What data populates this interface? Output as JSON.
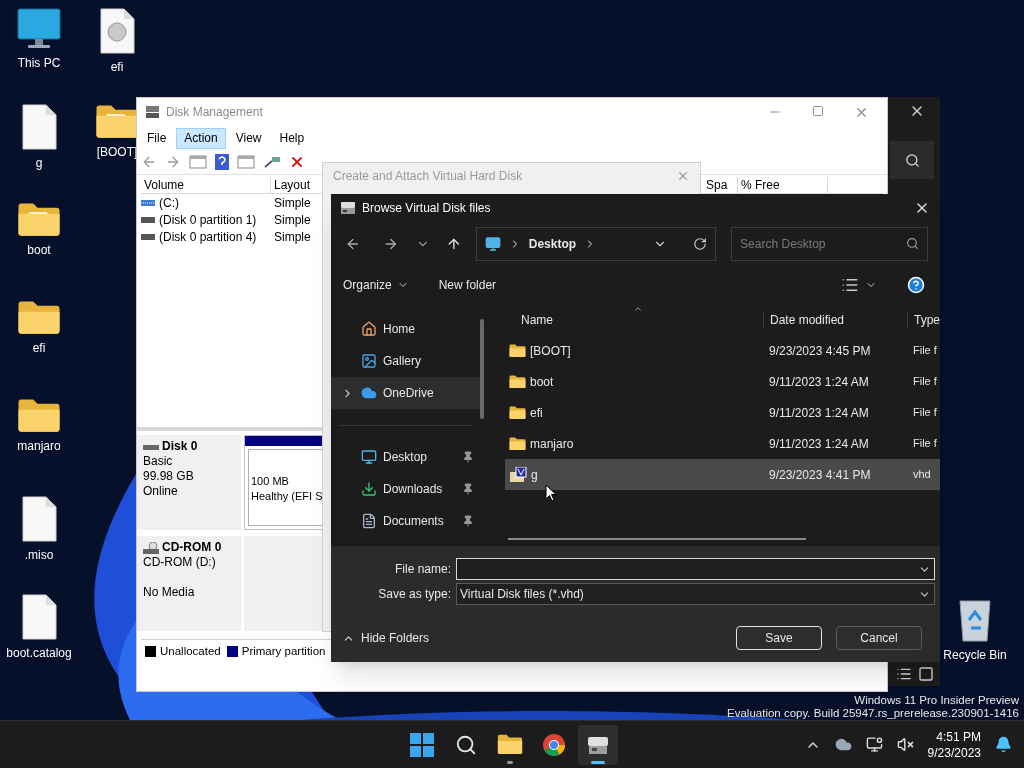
{
  "desktop": {
    "icons": [
      {
        "label": "This PC",
        "kind": "pc"
      },
      {
        "label": "g",
        "kind": "file"
      },
      {
        "label": "boot",
        "kind": "doc-folder"
      },
      {
        "label": "efi",
        "kind": "folder"
      },
      {
        "label": "manjaro",
        "kind": "folder"
      },
      {
        "label": ".miso",
        "kind": "file"
      },
      {
        "label": "boot.catalog",
        "kind": "file"
      },
      {
        "label": "efi",
        "kind": "disc-file"
      },
      {
        "label": "[BOOT]",
        "kind": "doc-folder"
      }
    ],
    "recycle_bin": {
      "label": "Recycle Bin"
    },
    "watermark": [
      "Windows 11 Pro Insider Preview",
      "Evaluation copy. Build 25947.rs_prerelease.230901-1416"
    ]
  },
  "disk_management": {
    "title": "Disk Management",
    "menu": [
      {
        "label": "File",
        "selected": false
      },
      {
        "label": "Action",
        "selected": true
      },
      {
        "label": "View",
        "selected": false
      },
      {
        "label": "Help",
        "selected": false
      }
    ],
    "volume_table": {
      "columns": [
        "Volume",
        "Layout",
        "Spa",
        "% Free"
      ],
      "rows": [
        {
          "volume": "(C:)",
          "layout": "Simple",
          "kind": "striped"
        },
        {
          "volume": "(Disk 0 partition 1)",
          "layout": "Simple",
          "kind": "plain"
        },
        {
          "volume": "(Disk 0 partition 4)",
          "layout": "Simple",
          "kind": "plain"
        }
      ]
    },
    "disks": [
      {
        "name": "Disk 0",
        "kind": "disk",
        "type": "Basic",
        "capacity": "99.98 GB",
        "status": "Online",
        "partition": {
          "size": "100 MB",
          "status": "Healthy (EFI S"
        }
      },
      {
        "name": "CD-ROM 0",
        "kind": "cdrom",
        "type": "CD-ROM (D:)",
        "status": "No Media"
      }
    ],
    "legend": [
      {
        "label": "Unallocated",
        "color": "#000000"
      },
      {
        "label": "Primary partition",
        "color": "#000080"
      }
    ]
  },
  "create_dialog": {
    "title": "Create and Attach Virtual Hard Disk"
  },
  "browse_dialog": {
    "title": "Browse Virtual Disk files",
    "address": {
      "location": "Desktop"
    },
    "search": {
      "placeholder": "Search Desktop"
    },
    "commands": [
      "Organize",
      "New folder"
    ],
    "nav": [
      {
        "label": "Home",
        "kind": "home",
        "selected": false,
        "expandable": false,
        "pinned": false
      },
      {
        "label": "Gallery",
        "kind": "gallery",
        "selected": false,
        "expandable": false,
        "pinned": false
      },
      {
        "label": "OneDrive",
        "kind": "cloud",
        "selected": true,
        "expandable": true,
        "pinned": false
      },
      {
        "label": "Desktop",
        "kind": "desktop",
        "selected": false,
        "expandable": false,
        "pinned": true
      },
      {
        "label": "Downloads",
        "kind": "downloads",
        "selected": false,
        "expandable": false,
        "pinned": true
      },
      {
        "label": "Documents",
        "kind": "documents",
        "selected": false,
        "expandable": false,
        "pinned": true
      }
    ],
    "columns": [
      "Name",
      "Date modified",
      "Type"
    ],
    "files": [
      {
        "name": "[BOOT]",
        "date": "9/23/2023 4:45 PM",
        "type": "File f",
        "kind": "folder",
        "selected": false
      },
      {
        "name": "boot",
        "date": "9/11/2023 1:24 AM",
        "type": "File f",
        "kind": "folder",
        "selected": false
      },
      {
        "name": "efi",
        "date": "9/11/2023 1:24 AM",
        "type": "File f",
        "kind": "folder",
        "selected": false
      },
      {
        "name": "manjaro",
        "date": "9/11/2023 1:24 AM",
        "type": "File f",
        "kind": "folder",
        "selected": false
      },
      {
        "name": "g",
        "date": "9/23/2023 4:41 PM",
        "type": "vhd",
        "kind": "vhd",
        "selected": true
      }
    ],
    "file_name": {
      "label": "File name:"
    },
    "save_type": {
      "label": "Save as type:",
      "value": "Virtual Disk files (*.vhd)"
    },
    "hide_folders": "Hide Folders",
    "buttons": [
      {
        "label": "Save",
        "kind": "default"
      },
      {
        "label": "Cancel",
        "kind": "normal"
      }
    ]
  },
  "taskbar": {
    "apps": [
      {
        "kind": "start",
        "selected": false,
        "running": false
      },
      {
        "kind": "search",
        "selected": false,
        "running": false
      },
      {
        "kind": "explorer",
        "selected": false,
        "running": true
      },
      {
        "kind": "browser",
        "selected": false,
        "running": false
      },
      {
        "kind": "disk-tool",
        "selected": true,
        "running": true
      }
    ],
    "clock": {
      "time": "4:51 PM",
      "date": "9/23/2023"
    }
  }
}
